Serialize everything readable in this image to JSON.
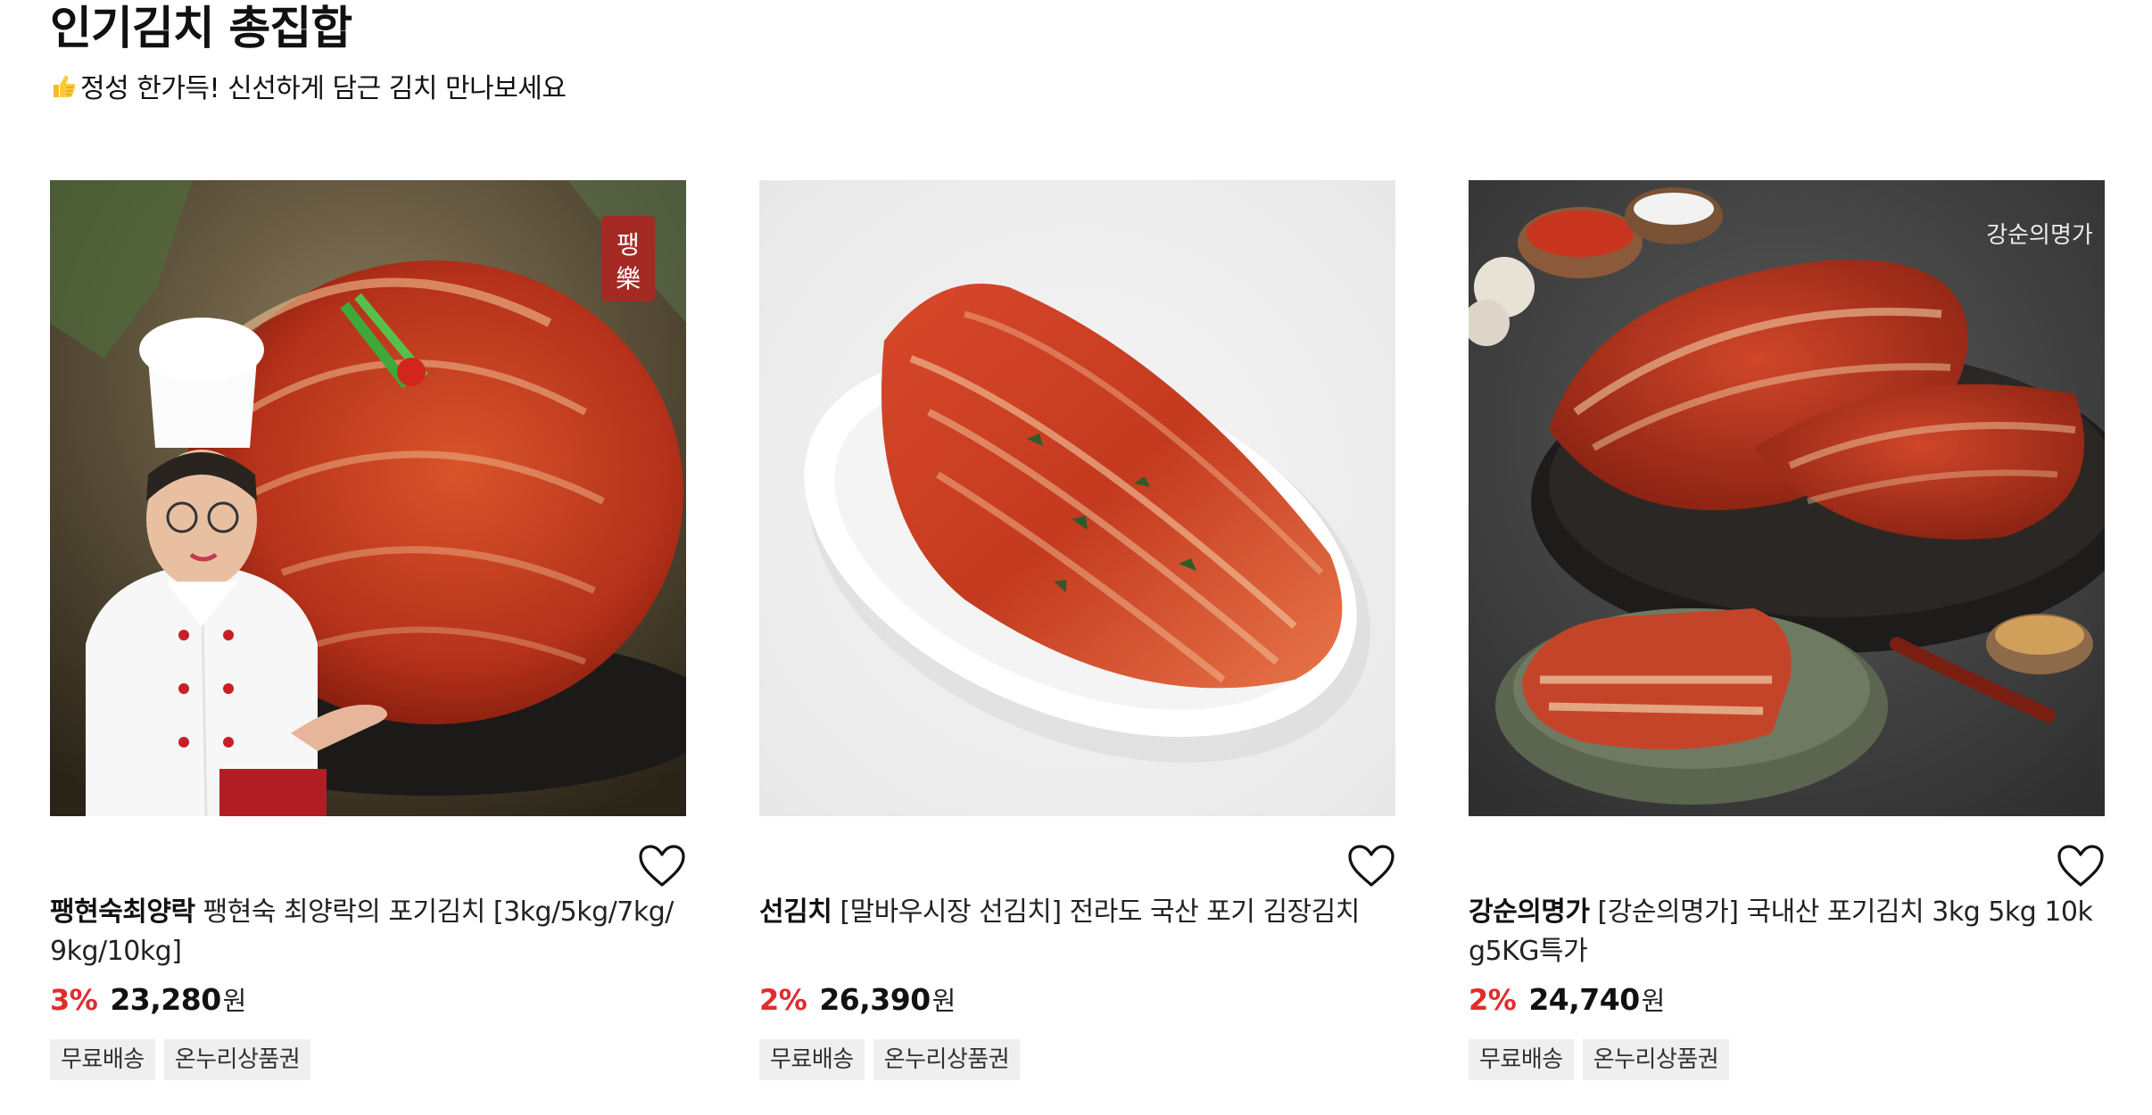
{
  "header": {
    "title": "인기김치 총집합",
    "subtitle": "정성 한가득! 신선하게 담근 김치 만나보세요",
    "subtitle_icon": "thumbs-up-icon"
  },
  "products": [
    {
      "brand": "팽현숙최양락",
      "name": "팽현숙 최양락의 포기김치 [3kg/5kg/7kg/9kg/10kg]",
      "discount": "3%",
      "price": "23,280",
      "currency": "원",
      "tags": [
        "무료배송",
        "온누리상품권"
      ],
      "image_label": "팽樂"
    },
    {
      "brand": "선김치",
      "name": "[말바우시장 선김치] 전라도 국산 포기 김장김치",
      "discount": "2%",
      "price": "26,390",
      "currency": "원",
      "tags": [
        "무료배송",
        "온누리상품권"
      ],
      "image_label": ""
    },
    {
      "brand": "강순의명가",
      "name": "[강순의명가] 국내산 포기김치 3kg 5kg 10kg5KG특가",
      "discount": "2%",
      "price": "24,740",
      "currency": "원",
      "tags": [
        "무료배송",
        "온누리상품권"
      ],
      "image_label": "강순의명가"
    }
  ],
  "colors": {
    "discount": "#e12c2c",
    "tag_bg": "#efefef",
    "text": "#111111"
  }
}
